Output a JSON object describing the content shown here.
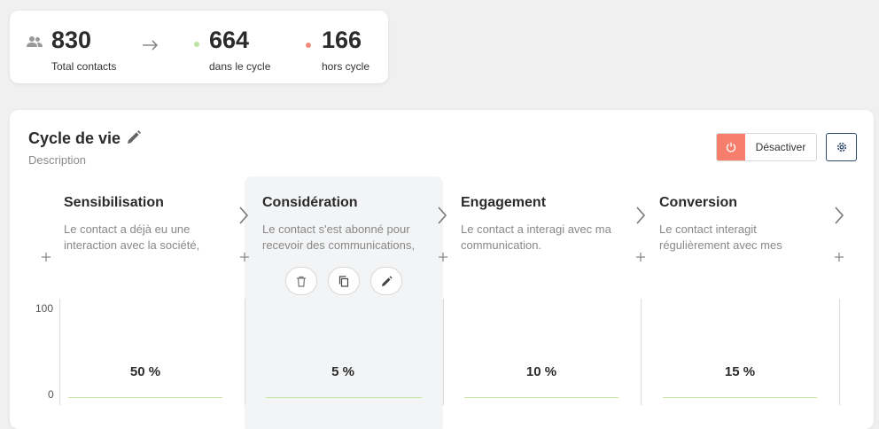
{
  "stats": {
    "total": {
      "value": "830",
      "label": "Total contacts"
    },
    "in_cycle": {
      "value": "664",
      "label": "dans le cycle"
    },
    "out_cycle": {
      "value": "166",
      "label": "hors cycle"
    }
  },
  "cycle": {
    "title": "Cycle de vie",
    "description": "Description",
    "deactivate_label": "Désactiver"
  },
  "chart": {
    "y_max_label": "100",
    "y_min_label": "0"
  },
  "stages": [
    {
      "title": "Sensibilisation",
      "text": "Le contact a déjà eu une interaction avec la société,",
      "percent_label": "50 %"
    },
    {
      "title": "Considération",
      "text": "Le contact s'est abonné pour recevoir des communications,",
      "percent_label": "5 %"
    },
    {
      "title": "Engagement",
      "text": "Le contact a interagi avec ma communication.",
      "percent_label": "10 %"
    },
    {
      "title": "Conversion",
      "text": "Le contact interagit régulièrement avec mes",
      "percent_label": "15 %"
    }
  ],
  "colors": {
    "in_cycle_dot": "#b9e3a1",
    "out_cycle_dot": "#f58b7a",
    "power_button": "#f77e6c",
    "bar_line": "#c5e8a2",
    "gear_border": "#2c4a6b"
  },
  "icons": {
    "users": "users-icon",
    "arrow": "arrow-right-icon",
    "pencil": "pencil-icon",
    "power": "power-icon",
    "gear": "gear-icon",
    "chevron": "chevron-right-icon",
    "plus": "plus-icon",
    "trash": "trash-icon",
    "copy": "copy-icon"
  }
}
